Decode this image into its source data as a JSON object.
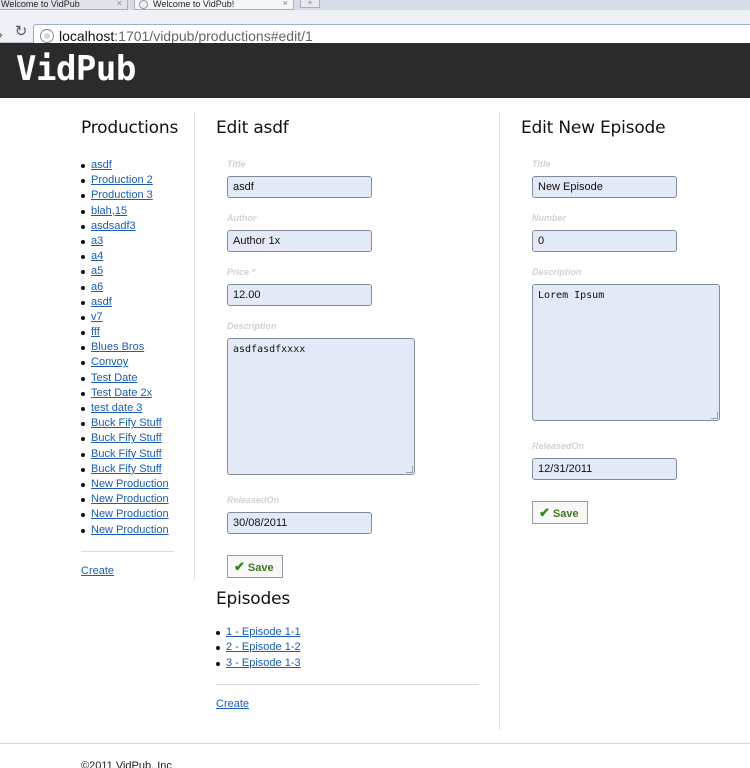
{
  "browser": {
    "tabs": [
      {
        "title": "Welcome to VidPub"
      },
      {
        "title": "Welcome to VidPub!"
      }
    ],
    "url_host": "localhost",
    "url_path": ":1701/vidpub/productions#edit/1"
  },
  "site": {
    "logo": "VidPub",
    "footer": "©2011 VidPub, Inc"
  },
  "productions": {
    "heading": "Productions",
    "items": [
      "asdf",
      "Production 2",
      "Production 3",
      "blah,15",
      "asdsadf3",
      "a3",
      "a4",
      "a5",
      "a6",
      "asdf",
      "v7",
      "fff",
      "Blues Bros",
      "Convoy",
      "Test Date",
      "Test Date 2x",
      "test date 3",
      "Buck Fify Stuff",
      "Buck Fify Stuff",
      "Buck Fify Stuff",
      "Buck Fify Stuff",
      "New Production",
      "New Production",
      "New Production",
      "New Production"
    ],
    "create_link": "Create"
  },
  "edit_production": {
    "heading": "Edit asdf",
    "title_label": "Title",
    "title_value": "asdf",
    "author_label": "Author",
    "author_value": "Author 1x",
    "price_label": "Price *",
    "price_value": "12.00",
    "description_label": "Description",
    "description_value": "asdfasdfxxxx",
    "released_label": "ReleasedOn",
    "released_value": "30/08/2011",
    "save_label": "Save"
  },
  "episodes": {
    "heading": "Episodes",
    "items": [
      "1 - Episode 1-1",
      "2 - Episode 1-2",
      "3 - Episode 1-3"
    ],
    "create_link": "Create"
  },
  "new_episode": {
    "heading": "Edit New Episode",
    "title_label": "Title",
    "title_value": "New Episode",
    "number_label": "Number",
    "number_value": "0",
    "description_label": "Description",
    "description_value": "Lorem Ipsum",
    "released_label": "ReleasedOn",
    "released_value": "12/31/2011",
    "save_label": "Save"
  }
}
